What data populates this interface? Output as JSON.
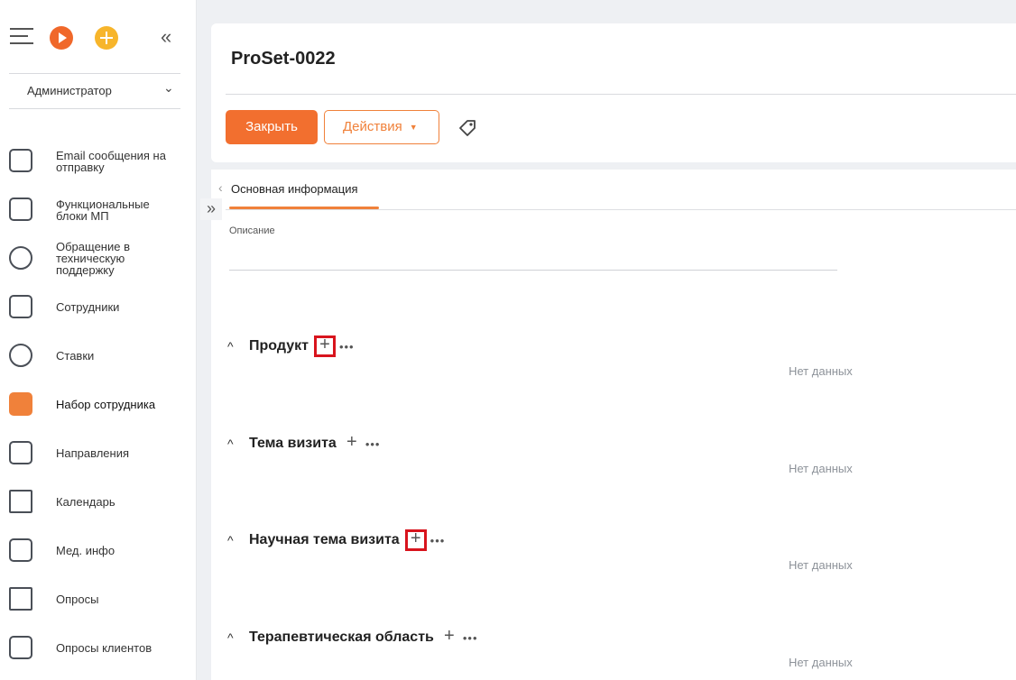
{
  "sidebar": {
    "role": "Администратор",
    "items": [
      {
        "label": "Email сообщения на отправку",
        "icon": "envelope-icon"
      },
      {
        "label": "Функциональные блоки МП",
        "icon": "blocks-icon"
      },
      {
        "label": "Обращение в техническую поддержку",
        "icon": "chat-icon"
      },
      {
        "label": "Сотрудники",
        "icon": "employee-icon"
      },
      {
        "label": "Ставки",
        "icon": "rates-icon"
      },
      {
        "label": "Набор сотрудника",
        "icon": "employee-set-icon"
      },
      {
        "label": "Направления",
        "icon": "document-icon"
      },
      {
        "label": "Календарь",
        "icon": "flag-icon"
      },
      {
        "label": "Мед. инфо",
        "icon": "message-icon"
      },
      {
        "label": "Опросы",
        "icon": "survey-icon"
      },
      {
        "label": "Опросы клиентов",
        "icon": "client-survey-icon"
      }
    ],
    "active_index": 5
  },
  "header": {
    "title": "ProSet-0022",
    "close_label": "Закрыть",
    "actions_label": "Действия"
  },
  "tabs": {
    "main": "Основная информация"
  },
  "form": {
    "description_label": "Описание"
  },
  "sections": [
    {
      "title": "Продукт",
      "empty": "Нет данных",
      "highlighted": true
    },
    {
      "title": "Тема визита",
      "empty": "Нет данных",
      "highlighted": false
    },
    {
      "title": "Научная тема визита",
      "empty": "Нет данных",
      "highlighted": true
    },
    {
      "title": "Терапевтическая область",
      "empty": "Нет данных",
      "highlighted": false
    }
  ],
  "colors": {
    "accent": "#f26f2f",
    "highlight": "#d8141d"
  }
}
